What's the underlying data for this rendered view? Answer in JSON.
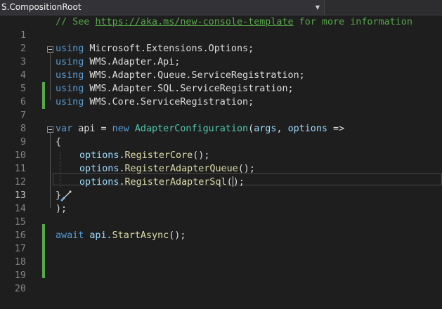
{
  "navbar": {
    "project_label": "S.CompositionRoot"
  },
  "editor": {
    "line_numbers": [
      "1",
      "2",
      "3",
      "4",
      "5",
      "6",
      "7",
      "8",
      "9",
      "10",
      "11",
      "12",
      "13",
      "14",
      "15",
      "16",
      "17",
      "18",
      "19",
      "20"
    ],
    "active_line": "13",
    "lines": {
      "l1": {
        "comment": "// See ",
        "url": "https://aka.ms/new-console-template",
        "tail": " for more information"
      },
      "l3": {
        "kw": "using",
        "ns": " Microsoft.Extensions.Options;"
      },
      "l4": {
        "kw": "using",
        "ns": " WMS.Adapter.Api;"
      },
      "l5": {
        "kw": "using",
        "ns": " WMS.Adapter.Queue.ServiceRegistration;"
      },
      "l6": {
        "kw": "using",
        "ns": " WMS.Adapter.SQL.ServiceRegistration;"
      },
      "l7": {
        "kw": "using",
        "ns": " WMS.Core.ServiceRegistration;"
      },
      "l9": {
        "kw_var": "var",
        "api": " api = ",
        "kw_new": "new",
        "sp": " ",
        "type": "AdapterConfiguration",
        "open": "(",
        "args": "args",
        "comma": ", ",
        "options": "options",
        "arrow": " =>"
      },
      "l10": {
        "text": "{"
      },
      "l11": {
        "obj": "options",
        "dot": ".",
        "method": "RegisterCore",
        "rest": "();"
      },
      "l12": {
        "obj": "options",
        "dot": ".",
        "method": "RegisterAdapterQueue",
        "rest": "();"
      },
      "l13": {
        "obj": "options",
        "dot": ".",
        "method": "RegisterAdapterSql",
        "paren": "(",
        "rest": ");"
      },
      "l14": {
        "text": "}"
      },
      "l15": {
        "text": ");"
      },
      "l17": {
        "kw": "await",
        "api": " api.",
        "method": "StartAsync",
        "rest": "();"
      }
    },
    "colors": {
      "keyword": "#569cd6",
      "type": "#4ec9b0",
      "method": "#dcdcaa",
      "parameter": "#9cdcfe",
      "comment": "#57a64a",
      "change_bar": "#57a64a"
    }
  }
}
